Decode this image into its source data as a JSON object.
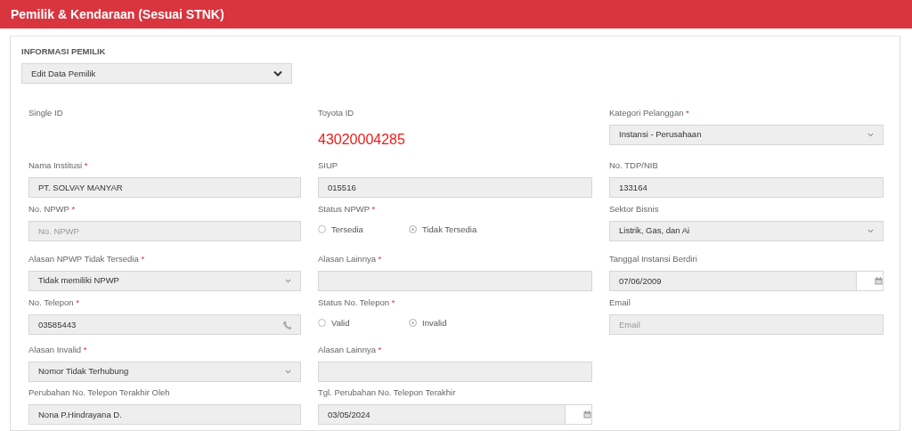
{
  "header": {
    "title": "Pemilik & Kendaraan (Sesuai STNK)"
  },
  "section": {
    "title": "INFORMASI PEMILIK",
    "mode_select": {
      "value": "Edit Data Pemilik"
    }
  },
  "rows": [
    [
      {
        "kind": "none",
        "label": "Single ID"
      },
      {
        "kind": "id",
        "label": "Toyota ID",
        "value": "43020004285"
      },
      {
        "kind": "select",
        "label": "Kategori Pelanggan",
        "required_mark": "*",
        "value": "Instansi - Perusahaan"
      }
    ],
    [
      {
        "kind": "text",
        "label": "Nama Institusi",
        "required_mark": "*",
        "value": "PT. SOLVAY MANYAR"
      },
      {
        "kind": "text",
        "label": "SIUP",
        "value": "015516"
      },
      {
        "kind": "text",
        "label": "No. TDP/NIB",
        "value": "133164"
      }
    ],
    [
      {
        "kind": "text",
        "label": "No. NPWP",
        "required_mark": "*",
        "placeholder": "No. NPWP"
      },
      {
        "kind": "radio",
        "label": "Status NPWP",
        "required_mark": "*",
        "options": [
          {
            "label": "Tersedia",
            "selected": false
          },
          {
            "label": "Tidak Tersedia",
            "selected": true
          }
        ]
      },
      {
        "kind": "select",
        "label": "Sektor Bisnis",
        "value": "Listrik, Gas, dan Ai"
      }
    ],
    [
      {
        "kind": "select",
        "label": "Alasan NPWP Tidak Tersedia",
        "required_mark": "*",
        "value": "Tidak memiliki NPWP"
      },
      {
        "kind": "text",
        "label": "Alasan Lainnya",
        "required_mark": "*"
      },
      {
        "kind": "date",
        "label": "Tanggal Instansi Berdiri",
        "value": "07/06/2009"
      }
    ],
    [
      {
        "kind": "phone",
        "label": "No. Telepon",
        "required_mark": "*",
        "value": "03585443"
      },
      {
        "kind": "radio",
        "label": "Status No. Telepon",
        "required_mark": "*",
        "options": [
          {
            "label": "Valid",
            "selected": false
          },
          {
            "label": "Invalid",
            "selected": true
          }
        ]
      },
      {
        "kind": "text",
        "label": "Email",
        "placeholder": "Email"
      }
    ],
    [
      {
        "kind": "select",
        "label": "Alasan Invalid",
        "required_mark": "*",
        "value": "Nomor Tidak Terhubung"
      },
      {
        "kind": "text",
        "label": "Alasan Lainnya",
        "required_mark": "*"
      }
    ],
    [
      {
        "kind": "text",
        "label": "Perubahan No. Telepon Terakhir Oleh",
        "value": "Nona P.Hindrayana D."
      },
      {
        "kind": "date",
        "label": "Tgl. Perubahan No. Telepon Terakhir",
        "value": "03/05/2024"
      }
    ]
  ]
}
